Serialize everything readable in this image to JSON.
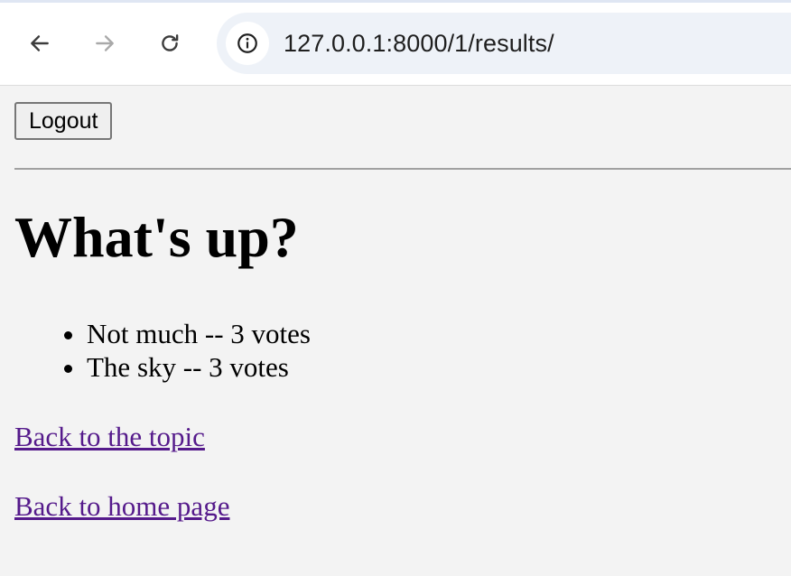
{
  "browser": {
    "url": "127.0.0.1:8000/1/results/",
    "back_icon": "arrow-left-icon",
    "forward_icon": "arrow-right-icon",
    "reload_icon": "reload-icon",
    "site_info_icon": "info-icon"
  },
  "page": {
    "logout_label": "Logout",
    "question": "What's up?",
    "results": [
      {
        "text": "Not much -- 3 votes"
      },
      {
        "text": "The sky -- 3 votes"
      }
    ],
    "back_to_topic": "Back to the topic",
    "back_to_home": "Back to home page"
  },
  "colors": {
    "page_background": "#f3f3f3",
    "visited_link": "#551a8b",
    "omnibox_background": "#eef2f8"
  }
}
